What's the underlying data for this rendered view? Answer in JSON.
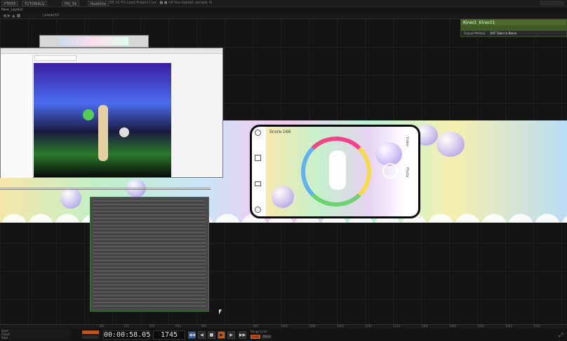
{
  "menubar": {
    "items": [
      "FTEMP",
      "TUTORIALS",
      "PRJ_39",
      "Realtime"
    ],
    "title_text": "EB 1E-FG Load Project Cue · ■ ■ (of the market sample 4)"
  },
  "tabbar": {
    "label": "New_Layout"
  },
  "pathbar": {
    "path": "/ project1"
  },
  "param_panel": {
    "name": "Kinect",
    "value": "Kinect1",
    "sub_label": "Output Method",
    "sub_value": "DAT Table to Name"
  },
  "phone": {
    "score": "Score:166",
    "side_labels": [
      "Video",
      "Photo"
    ]
  },
  "bottom": {
    "info_lines": [
      "Start",
      "FStart",
      "Rate"
    ],
    "timecode": "00:00:58.05",
    "frame": "1745",
    "range_label": "Range Limit",
    "range_opts": [
      "Loop",
      "Once"
    ]
  },
  "ruler_ticks": [
    "281",
    "321",
    "521",
    "601",
    "681",
    "841",
    "1001",
    "1081",
    "1161",
    "1241",
    "1321",
    "1401",
    "1481",
    "1561",
    "1641",
    "1721"
  ],
  "colors": {
    "accent_green": "#4d6b2c",
    "accent_orange": "#c0581e"
  }
}
